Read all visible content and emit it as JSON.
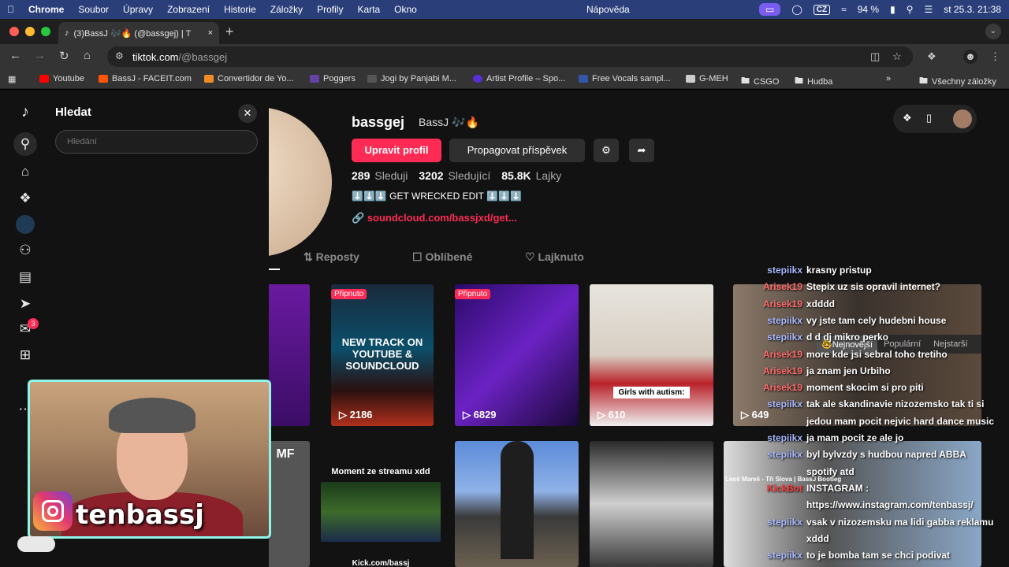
{
  "menubar": {
    "app": "Chrome",
    "items": [
      "Soubor",
      "Úpravy",
      "Zobrazení",
      "Historie",
      "Záložky",
      "Profily",
      "Karta",
      "Okno"
    ],
    "help": "Nápověda",
    "lang": "CZ",
    "battery": "94 %",
    "clock": "st 25.3. 21:38"
  },
  "tab": {
    "title": "(3)BassJ 🎶🔥 (@bassgej) | T",
    "close": "×",
    "new": "+"
  },
  "omnibox": {
    "host": "tiktok.com",
    "path": "/@bassgej"
  },
  "bookmarks": [
    {
      "label": "Youtube",
      "color": "#ff0000"
    },
    {
      "label": "BassJ - FACEIT.com",
      "color": "#ff5500"
    },
    {
      "label": "Convertidor de Yo...",
      "color": "#f08a24"
    },
    {
      "label": "Poggers",
      "color": "#6441a5"
    },
    {
      "label": "Jogi by Panjabi M...",
      "color": "#555555"
    },
    {
      "label": "Artist Profile – Spo...",
      "color": "#5b2dd8"
    },
    {
      "label": "Free Vocals sampl...",
      "color": "#3355aa"
    },
    {
      "label": "G-MEH",
      "color": "#cccccc"
    },
    {
      "label": "CSGO",
      "color": "#888888"
    },
    {
      "label": "Hudba",
      "color": "#888888"
    }
  ],
  "bookmarks_more": "»",
  "bookmarks_all": "Všechny záložky",
  "search": {
    "title": "Hledat",
    "placeholder": "Hledání"
  },
  "nav_badge": "3",
  "profile": {
    "username": "bassgej",
    "nickname": "BassJ 🎶🔥",
    "edit": "Upravit profil",
    "promote": "Propagovat příspěvek",
    "following_count": "289",
    "following_label": "Sleduji",
    "followers_count": "3202",
    "followers_label": "Sledující",
    "likes_count": "85.8K",
    "likes_label": "Lajky",
    "bio": "⬇️⬇️⬇️ GET WRECKED EDIT ⬇️⬇️⬇️",
    "link": "soundcloud.com/bassjxd/get..."
  },
  "tabs": [
    "Reposty",
    "Oblíbené",
    "Lajknuto"
  ],
  "videos_row1": [
    {
      "views": "",
      "pinned": false
    },
    {
      "views": "2186",
      "pinned": true,
      "pin_label": "Připnuto",
      "text": "NEW TRACK ON YOUTUBE & SOUNDCLOUD"
    },
    {
      "views": "6829",
      "pinned": true,
      "pin_label": "Připnuto"
    },
    {
      "views": "610",
      "pinned": false,
      "text": "Girls with autism:"
    },
    {
      "views": "649",
      "pinned": false
    }
  ],
  "videos_row2": [
    {
      "text": "MF"
    },
    {
      "text": "Moment ze streamu xdd",
      "caption": "Kick.com/bassj"
    },
    {
      "text": ""
    },
    {
      "text": ""
    },
    {
      "text": "Leoš Mareš - Tři Slova | BassJ Bootleg"
    }
  ],
  "sort": {
    "newest": "🤓Nejnovější",
    "popular": "Populární",
    "oldest": "Nejstarší"
  },
  "chat": [
    {
      "user": "stepiikx",
      "msg": "krasny pristup",
      "color": "#a9b8ff"
    },
    {
      "user": "Arisek19",
      "msg": "Stepix uz sis opravil internet?",
      "color": "#ff6b6b"
    },
    {
      "user": "Arisek19",
      "msg": "xdddd",
      "color": "#ff6b6b"
    },
    {
      "user": "stepiikx",
      "msg": "vy jste tam cely hudebni house",
      "color": "#a9b8ff"
    },
    {
      "user": "stepiikx",
      "msg": "d d dj mikro perko",
      "color": "#a9b8ff"
    },
    {
      "user": "Arisek19",
      "msg": "more kde jsi sebral toho tretiho",
      "color": "#ff6b6b"
    },
    {
      "user": "Arisek19",
      "msg": "ja znam jen Urbiho",
      "color": "#ff6b6b"
    },
    {
      "user": "Arisek19",
      "msg": "moment skocim si pro piti",
      "color": "#ff6b6b"
    },
    {
      "user": "stepiikx",
      "msg": "tak ale skandinavie nizozemsko tak ti si",
      "color": "#a9b8ff"
    },
    {
      "user": "",
      "msg": "jedou mam pocit nejvic hard dance music",
      "color": "#a9b8ff"
    },
    {
      "user": "stepiikx",
      "msg": "ja mam pocit ze ale jo",
      "color": "#a9b8ff"
    },
    {
      "user": "stepiikx",
      "msg": "byl bylvzdy s hudbou napred ABBA",
      "color": "#a9b8ff"
    },
    {
      "user": "",
      "msg": "spotify atd",
      "color": "#a9b8ff"
    },
    {
      "user": "KickBot",
      "msg": "INSTAGRAM :",
      "color": "#ff3b3b"
    },
    {
      "user": "",
      "msg": "https://www.instagram.com/tenbassj/",
      "color": "#ff3b3b"
    },
    {
      "user": "stepiikx",
      "msg": "vsak v nizozemsku ma lidi gabba reklamu",
      "color": "#a9b8ff"
    },
    {
      "user": "",
      "msg": "xddd",
      "color": "#a9b8ff"
    },
    {
      "user": "stepiikx",
      "msg": "to je bomba tam se chci podivat",
      "color": "#a9b8ff"
    }
  ],
  "webcam": {
    "handle": "tenbassj"
  }
}
